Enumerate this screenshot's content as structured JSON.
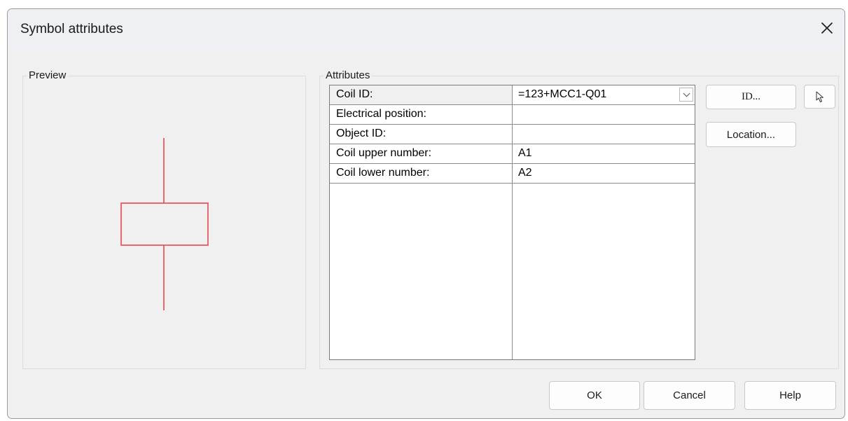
{
  "window": {
    "title": "Symbol attributes",
    "close_glyph": "✕"
  },
  "preview": {
    "label": "Preview",
    "symbol_color": "#e8474f",
    "symbol_icon": "coil-symbol-icon"
  },
  "attributes": {
    "label": "Attributes",
    "rows": [
      {
        "name": "Coil ID:",
        "value": "=123+MCC1-Q01",
        "has_dropdown": true
      },
      {
        "name": "Electrical position:",
        "value": ""
      },
      {
        "name": "Object ID:",
        "value": ""
      },
      {
        "name": "Coil upper number:",
        "value": "A1"
      },
      {
        "name": "Coil lower number:",
        "value": "A2"
      }
    ]
  },
  "side_buttons": {
    "id_label": "ID...",
    "location_label": "Location...",
    "pick_icon": "pointer-select-icon"
  },
  "footer": {
    "ok_label": "OK",
    "cancel_label": "Cancel",
    "help_label": "Help"
  }
}
